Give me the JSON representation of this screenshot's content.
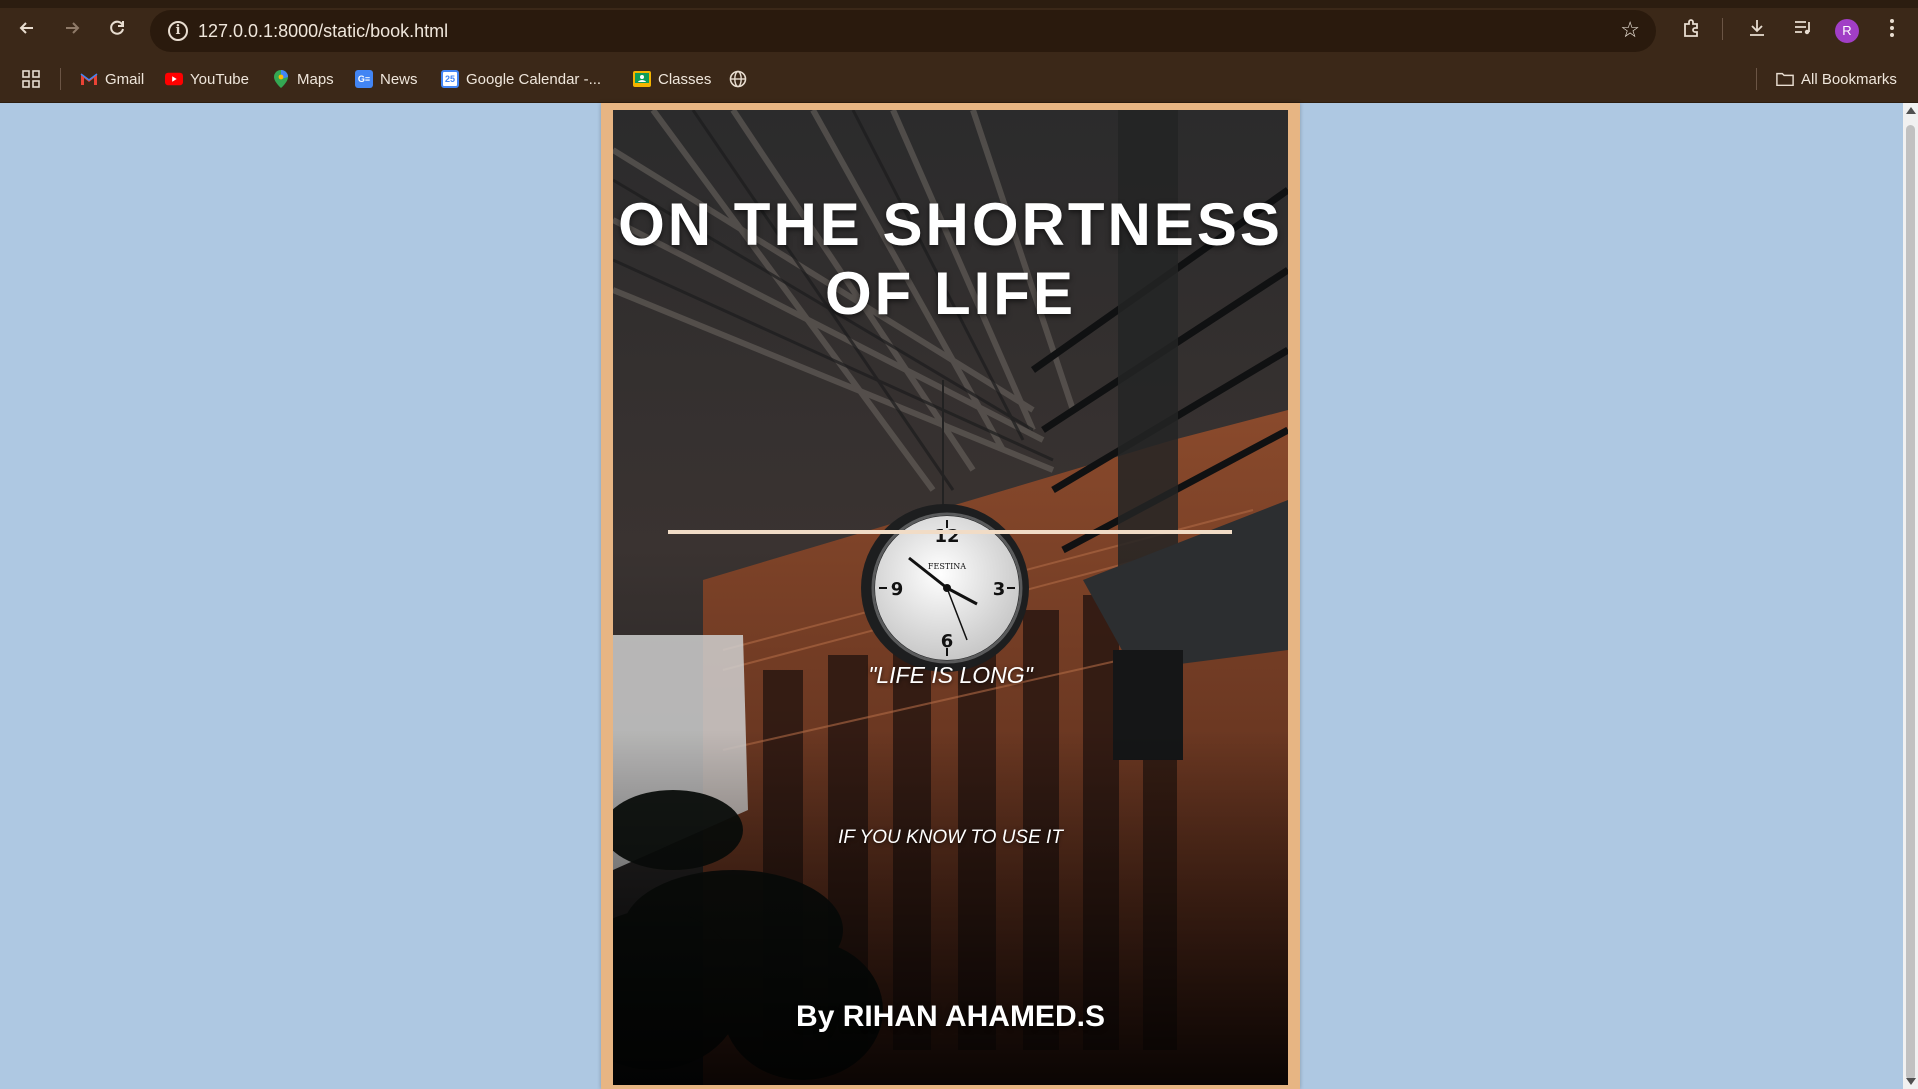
{
  "browser": {
    "url": "127.0.0.1:8000/static/book.html",
    "profile_initial": "R",
    "bookmarks": [
      {
        "label": "Gmail",
        "icon": "gmail-icon"
      },
      {
        "label": "YouTube",
        "icon": "youtube-icon"
      },
      {
        "label": "Maps",
        "icon": "maps-icon"
      },
      {
        "label": "News",
        "icon": "news-icon"
      },
      {
        "label": "Google Calendar -...",
        "icon": "calendar-icon"
      },
      {
        "label": "Classes",
        "icon": "classes-icon"
      }
    ],
    "all_bookmarks_label": "All Bookmarks",
    "calendar_day": "25",
    "news_abbrev": "G≡"
  },
  "book": {
    "title": "ON THE SHORTNESS OF LIFE",
    "subtitle": "\"LIFE IS LONG\"",
    "tagline": "IF YOU KNOW TO USE IT",
    "author": "By RIHAN AHAMED.S",
    "clock_brand": "FESTINA",
    "clock_numerals": [
      "12",
      "3",
      "6",
      "9"
    ]
  },
  "colors": {
    "page_background": "#aec8e2",
    "frame": "#e7b583",
    "chrome": "#3b2818"
  }
}
